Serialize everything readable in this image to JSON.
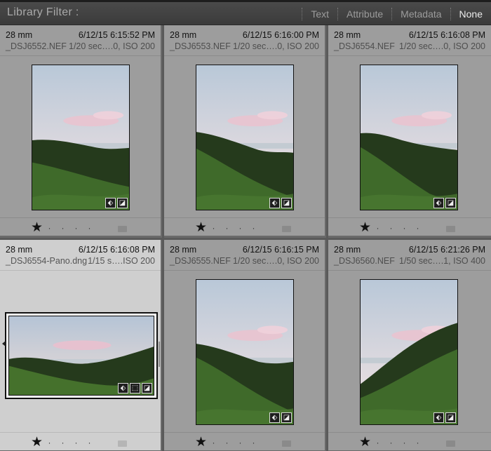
{
  "filterbar": {
    "title": "Library Filter :",
    "options": [
      {
        "label": "Text",
        "active": false
      },
      {
        "label": "Attribute",
        "active": false
      },
      {
        "label": "Metadata",
        "active": false
      },
      {
        "label": "None",
        "active": true
      }
    ]
  },
  "cells": [
    {
      "focal": "28 mm",
      "datetime": "6/12/15 6:15:52 PM",
      "filename": "_DSJ6552.NEF",
      "exposure": "1/20 sec….0, ISO 200",
      "rating_star": "★",
      "orientation": "portrait",
      "selected": false
    },
    {
      "focal": "28 mm",
      "datetime": "6/12/15 6:16:00 PM",
      "filename": "_DSJ6553.NEF",
      "exposure": "1/20 sec….0, ISO 200",
      "rating_star": "★",
      "orientation": "portrait",
      "selected": false
    },
    {
      "focal": "28 mm",
      "datetime": "6/12/15 6:16:08 PM",
      "filename": "_DSJ6554.NEF",
      "exposure": "1/20 sec….0, ISO 200",
      "rating_star": "★",
      "orientation": "portrait",
      "selected": false
    },
    {
      "focal": "28 mm",
      "datetime": "6/12/15 6:16:08 PM",
      "filename": "_DSJ6554-Pano.dng",
      "exposure": "1/15 s….ISO 200",
      "rating_star": "★",
      "orientation": "landscape",
      "selected": true
    },
    {
      "focal": "28 mm",
      "datetime": "6/12/15 6:16:15 PM",
      "filename": "_DSJ6555.NEF",
      "exposure": "1/20 sec….0, ISO 200",
      "rating_star": "★",
      "orientation": "portrait",
      "selected": false
    },
    {
      "focal": "28 mm",
      "datetime": "6/12/15 6:21:26 PM",
      "filename": "_DSJ6560.NEF",
      "exposure": "1/50 sec….1, ISO 400",
      "rating_star": "★",
      "orientation": "portrait",
      "selected": false
    }
  ]
}
